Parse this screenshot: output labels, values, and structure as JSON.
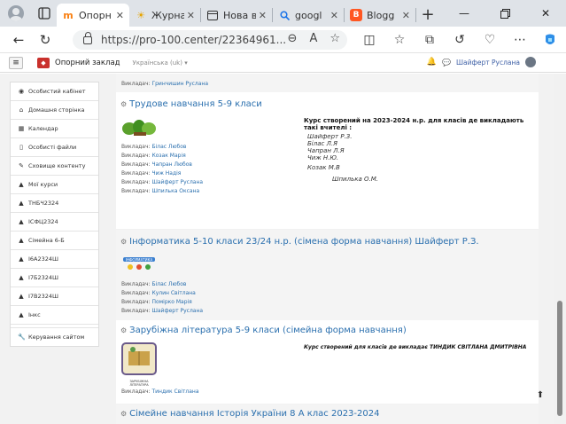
{
  "browser": {
    "tabs": [
      {
        "title": "Опорн",
        "favicon": "moodle-icon",
        "fav_color": "#f98012",
        "active": true
      },
      {
        "title": "Журна",
        "favicon": "sun-icon",
        "fav_color": "#e6a400",
        "active": false
      },
      {
        "title": "Нова в",
        "favicon": "tab-page-icon",
        "fav_color": "#333333",
        "active": false
      },
      {
        "title": "googl",
        "favicon": "search-icon",
        "fav_color": "#1a73e8",
        "active": false
      },
      {
        "title": "Blogg",
        "favicon": "blogger-icon",
        "fav_color": "#ff5722",
        "active": false
      }
    ],
    "url": "https://pro-100.center/22364961..."
  },
  "site": {
    "name": "Опорний заклад",
    "language": "Українська (uk)",
    "user": "Шайферт Руслана"
  },
  "sidebar": {
    "items": [
      {
        "label": "Особистий кабінет",
        "icon": "dashboard-icon"
      },
      {
        "label": "Домашня сторінка",
        "icon": "home-icon"
      },
      {
        "label": "Календар",
        "icon": "calendar-icon"
      },
      {
        "label": "Особисті файли",
        "icon": "file-icon"
      },
      {
        "label": "Сховище контенту",
        "icon": "pencil-icon"
      },
      {
        "label": "Мої курси",
        "icon": "graduation-cap-icon"
      },
      {
        "label": "ТНБЧ2324",
        "icon": "graduation-cap-icon"
      },
      {
        "label": "ІСФЦ2324",
        "icon": "graduation-cap-icon"
      },
      {
        "label": "Сімейна 6-Б",
        "icon": "graduation-cap-icon"
      },
      {
        "label": "І6А2324Ш",
        "icon": "graduation-cap-icon"
      },
      {
        "label": "І7Б2324Ш",
        "icon": "graduation-cap-icon"
      },
      {
        "label": "І7В2324Ш",
        "icon": "graduation-cap-icon"
      },
      {
        "label": "Інкс",
        "icon": "graduation-cap-icon"
      },
      {
        "label": "Керування сайтом",
        "icon": "wrench-icon"
      }
    ]
  },
  "courses": {
    "top_teacher": {
      "prefix": "Викладач:",
      "name": "Гринчишин Руслана"
    },
    "trudove": {
      "title": "Трудове навчання 5-9 класи",
      "teachers": [
        {
          "prefix": "Викладач:",
          "name": "Білас Любов"
        },
        {
          "prefix": "Викладач:",
          "name": "Козак Марія"
        },
        {
          "prefix": "Викладач:",
          "name": "Чапран Любов"
        },
        {
          "prefix": "Викладач:",
          "name": "Чиж Надія"
        },
        {
          "prefix": "Викладач:",
          "name": "Шайферт Руслана"
        },
        {
          "prefix": "Викладач:",
          "name": "Шпилька Оксана"
        }
      ],
      "desc_heading": "Курс створений на 2023-2024 н.р. для класів де викладають такі вчителі :",
      "desc_names": [
        "Шайферт Р.З.",
        "Білас Л.Я",
        "Чапран Л.Я",
        "Чиж Н.Ю.",
        "Козак М.В",
        "Шпилька О.М."
      ]
    },
    "informatyka": {
      "title": "Інформатика 5-10 класи 23/24 н.р. (сімена форма навчання) Шайферт Р.З.",
      "teachers": [
        {
          "prefix": "Викладач:",
          "name": "Білас Любов"
        },
        {
          "prefix": "Викладач:",
          "name": "Кулин Світлана"
        },
        {
          "prefix": "Викладач:",
          "name": "Поміркo Марія"
        },
        {
          "prefix": "Викладач:",
          "name": "Шайферт Руслана"
        }
      ]
    },
    "zarubizhna": {
      "title": "Зарубіжна література 5-9 класи (сімейна форма навчання)",
      "image_caption": "ЗАРУБІЖНА ЛІТЕРАТУРА",
      "desc": "Курс створений для класів де викладає ТИНДИК СВІТЛАНА ДМИТРІВНА",
      "teachers": [
        {
          "prefix": "Викладач:",
          "name": "Тиндик Світлана"
        }
      ]
    },
    "simeine": {
      "title": "Сімейне навчання Історія України 8 А клас 2023-2024"
    }
  }
}
